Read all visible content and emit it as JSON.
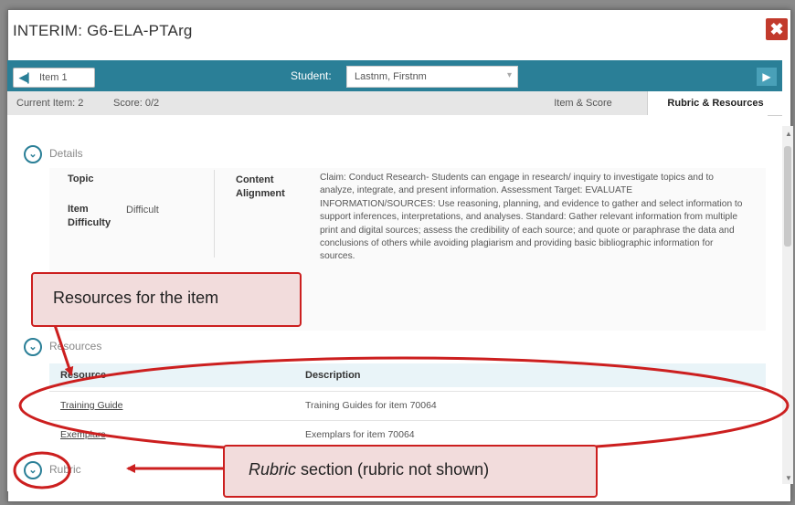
{
  "window": {
    "title": "INTERIM: G6-ELA-PTArg",
    "close_glyph": "✖"
  },
  "toolbar": {
    "item_label": "Item 1",
    "student_label": "Student:",
    "student_value": "Lastnm, Firstnm"
  },
  "status": {
    "current_item": "Current Item: 2",
    "score": "Score: 0/2"
  },
  "tabs": {
    "item_score": "Item & Score",
    "rubric_resources": "Rubric & Resources",
    "active": "Rubric & Resources"
  },
  "details": {
    "heading": "Details",
    "topic_label": "Topic",
    "difficulty_label": "Item Difficulty",
    "difficulty_value": "Difficult",
    "content_alignment_label": "Content Alignment",
    "content_alignment_text": "Claim: Conduct Research- Students can engage in research/ inquiry to investigate topics and to analyze, integrate, and present information. Assessment Target: EVALUATE INFORMATION/SOURCES: Use reasoning, planning, and evidence to gather and select information to support inferences, interpretations, and analyses. Standard: Gather relevant information from multiple print and digital sources; assess the credibility of each source; and quote or paraphrase the data and conclusions of others while avoiding plagiarism and providing basic bibliographic information for sources."
  },
  "resources": {
    "heading": "Resources",
    "col_resource": "Resource",
    "col_description": "Description",
    "rows": [
      {
        "resource": "Training Guide",
        "description": "Training Guides for item 70064"
      },
      {
        "resource": "Exemplars",
        "description": "Exemplars for item 70064"
      }
    ]
  },
  "rubric": {
    "heading": "Rubric"
  },
  "annotations": {
    "callout_resources": "Resources for the item",
    "callout_rubric_em": "Rubric",
    "callout_rubric_rest": " section (rubric not shown)",
    "color": "#cc1f1f"
  },
  "colors": {
    "accent": "#2a7f97",
    "close": "#c23a2c"
  }
}
